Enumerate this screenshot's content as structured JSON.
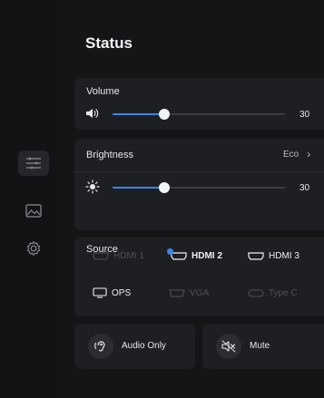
{
  "page_title": "Status",
  "volume": {
    "label": "Volume",
    "value": "30",
    "level": 0.3,
    "icon": "speaker-icon"
  },
  "brightness": {
    "label": "Brightness",
    "mode": "Eco",
    "mode_chevron": "›",
    "value": "30",
    "level": 0.3,
    "icon": "sun-icon"
  },
  "source": {
    "label": "Source",
    "options": [
      {
        "label": "HDMI 1",
        "state": "disabled"
      },
      {
        "label": "HDMI 2",
        "state": "selected"
      },
      {
        "label": "HDMI 3",
        "state": "available"
      },
      {
        "label": "OPS",
        "state": "available"
      },
      {
        "label": "VGA",
        "state": "disabled"
      },
      {
        "label": "Type C",
        "state": "disabled"
      }
    ]
  },
  "actions": [
    {
      "label": "Audio Only",
      "icon": "ear-icon"
    },
    {
      "label": "Mute",
      "icon": "mute-icon"
    }
  ],
  "sidebar": [
    {
      "name": "settings-list-icon",
      "active": true
    },
    {
      "name": "picture-icon",
      "active": false
    },
    {
      "name": "gear-icon",
      "active": false
    }
  ],
  "colors": {
    "accent": "#3d86e8",
    "card": "#1e1f23",
    "background": "#101113"
  }
}
